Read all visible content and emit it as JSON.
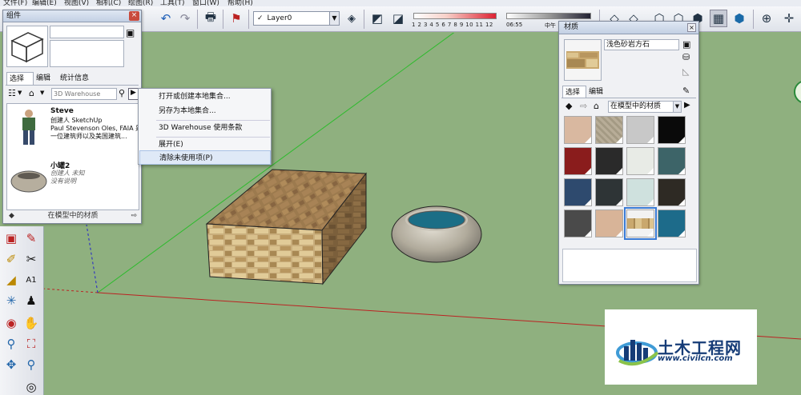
{
  "menu": {
    "items": [
      "文件(F)",
      "编辑(E)",
      "视图(V)",
      "相机(C)",
      "绘图(R)",
      "工具(T)",
      "窗口(W)",
      "帮助(H)"
    ]
  },
  "toolbar": {
    "layer": "Layer0",
    "shadow_scale_numbers": "1 2 3 4 5 6 7 8 9 10 11 12",
    "time_start": "06:55",
    "time_mid": "中午"
  },
  "components_panel": {
    "title": "组件",
    "tabs": [
      "选择",
      "编辑",
      "统计信息"
    ],
    "search_placeholder": "3D Warehouse",
    "items": [
      {
        "name": "Steve",
        "creator": "创建人 SketchUp",
        "desc1": "Paul Stevenson Oles, FAIA 是",
        "desc2": "一位建筑师以及美国建筑..."
      },
      {
        "name": "小罐2",
        "creator": "创建人 未知",
        "desc1": "没有说明"
      }
    ],
    "footer": "在模型中的材质"
  },
  "context_menu": {
    "items": [
      "打开或创建本地集合...",
      "另存为本地集合...",
      "3D Warehouse 使用条款",
      "展开(E)",
      "清除未使用项(P)"
    ]
  },
  "materials_panel": {
    "title": "材质",
    "material_name": "浅色砂岩方石",
    "tabs": [
      "选择",
      "编辑"
    ],
    "collection": "在模型中的材质",
    "swatches": [
      "#d9b8a0",
      "#b8ad98",
      "#c8c8c8",
      "#0a0a0a",
      "#8a1c1c",
      "#2a2a2a",
      "#e8ebe6",
      "#3d6468",
      "#2e4a6e",
      "#2e3436",
      "#cfe1de",
      "#2e2a24",
      "#4a4a4a",
      "#d8b498",
      "#c9a86e",
      "#1d6b8a"
    ],
    "selected_index": 14
  },
  "watermark": {
    "main": "土木工程网",
    "url": "www.civilcn.com"
  },
  "colors": {
    "ground": "#8fb07f",
    "panel": "#f0f1f4",
    "highlight": "#dfe9f7",
    "watermark_blue": "#163c77"
  }
}
